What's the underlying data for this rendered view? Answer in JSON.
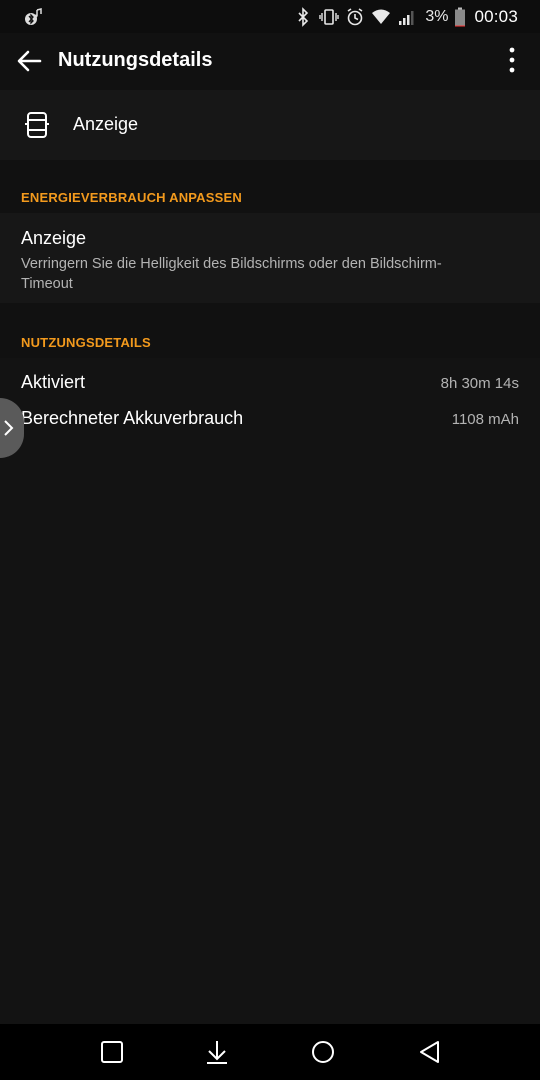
{
  "status_bar": {
    "left_icons": [
      "bluetooth-music-icon"
    ],
    "right_icons": [
      "bluetooth-icon",
      "vibrate-icon",
      "alarm-icon",
      "wifi-icon",
      "signal-icon"
    ],
    "battery_percent": "3%",
    "battery_level": 0.03,
    "time": "00:03"
  },
  "app_bar": {
    "back_icon": "arrow-left-icon",
    "title": "Nutzungsdetails",
    "more_icon": "more-vert-icon"
  },
  "app_entry": {
    "icon": "display-icon",
    "label": "Anzeige"
  },
  "energy_section": {
    "header": "ENERGIEVERBRAUCH ANPASSEN",
    "item_title": "Anzeige",
    "item_description": "Verringern Sie die Helligkeit des Bildschirms oder den Bildschirm-Timeout"
  },
  "usage_section": {
    "header": "NUTZUNGSDETAILS",
    "rows": [
      {
        "label": "Aktiviert",
        "value": "8h 30m 14s"
      },
      {
        "label": "Berechneter Akkuverbrauch",
        "value": "1108 mAh"
      }
    ]
  },
  "edge_panel": {
    "icon": "chevron-right-icon"
  },
  "nav_bar": {
    "buttons": [
      "recent-apps-icon",
      "notifications-pull-icon",
      "home-icon",
      "back-icon"
    ]
  },
  "colors": {
    "accent": "#f39a1d",
    "background": "#111111",
    "card": "#171717",
    "text_primary": "#ffffff",
    "text_secondary": "#b3b3b3"
  }
}
